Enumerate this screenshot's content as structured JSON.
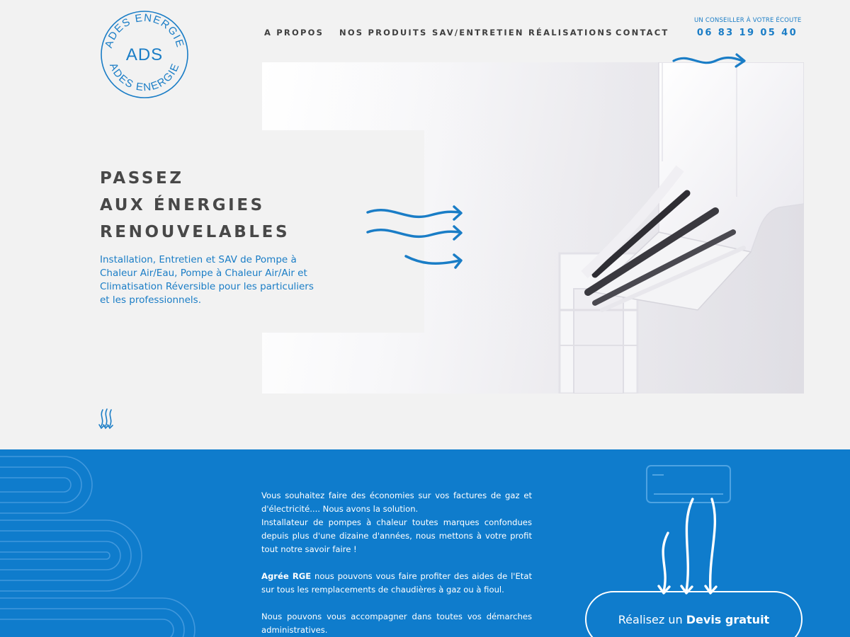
{
  "brand": {
    "logo_mark": "ADS",
    "logo_ring_text": "ADES ENERGIE",
    "color": "#1a7dc6"
  },
  "nav": {
    "items": [
      {
        "label": "A PROPOS"
      },
      {
        "label": "NOS PRODUITS"
      },
      {
        "label": "SAV/ENTRETIEN"
      },
      {
        "label": "RÉALISATIONS"
      },
      {
        "label": "CONTACT"
      }
    ]
  },
  "contact": {
    "advisor_label": "UN CONSEILLER À VOTRE ÉCOUTE",
    "phone": "06 83 19 05 40"
  },
  "hero": {
    "headline_lines": [
      "PASSEZ",
      "AUX ÉNERGIES",
      "RENOUVELABLES"
    ],
    "description": "Installation, Entretien et SAV de Pompe à Chaleur Air/Eau, Pompe à Chaleur Air/Air et Climatisation Réversible pour les particuliers et les professionnels.",
    "image_subject": "air-conditioner-photo"
  },
  "intro": {
    "paragraph1": "Vous souhaitez faire des économies sur vos factures de gaz et d'électricité.... Nous avons la solution.",
    "paragraph2": "Installateur de pompes à chaleur toutes marques confondues depuis plus d'une dizaine d'années, nous mettons à votre profit tout notre savoir faire !",
    "rge_bold": "Agrée RGE",
    "rge_text": " nous pouvons vous faire profiter des aides de l'Etat sur tous les remplacements de chaudières à gaz ou à fioul.",
    "paragraph4": "Nous pouvons vous accompagner dans toutes vos démarches administratives."
  },
  "cta": {
    "prefix": "Réalisez un ",
    "bold": "Devis gratuit"
  },
  "colors": {
    "accent": "#1a7dc6",
    "section_blue": "#0f7ccc",
    "background": "#f2f2f2",
    "heading": "#484848"
  },
  "icons": [
    "ads-logo",
    "air-flow-icon",
    "scroll-down-icon",
    "air-conditioner-icon"
  ]
}
